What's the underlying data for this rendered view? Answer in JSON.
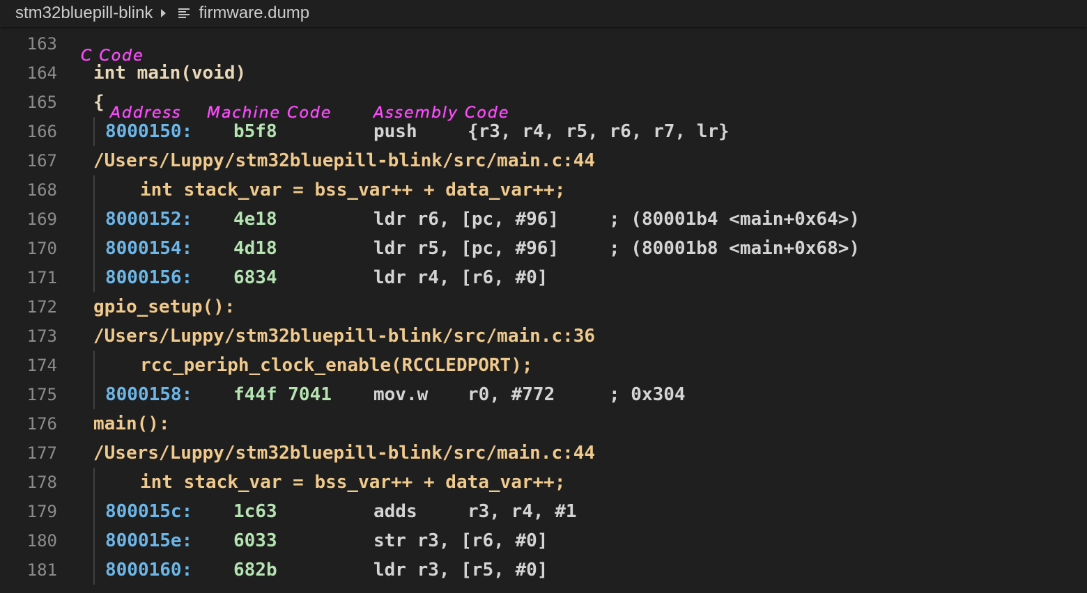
{
  "breadcrumb": {
    "folder": "stm32bluepill-blink",
    "file": "firmware.dump"
  },
  "annotations": {
    "c_code": "C Code",
    "address": "Address",
    "machine_code": "Machine Code",
    "assembly_code": "Assembly Code"
  },
  "lines": [
    {
      "num": "163",
      "kind": "blank"
    },
    {
      "num": "164",
      "kind": "plain",
      "text": "int main(void)"
    },
    {
      "num": "165",
      "kind": "plain",
      "text": "{"
    },
    {
      "num": "166",
      "kind": "asm",
      "addr": "8000150:",
      "mc": "b5f8",
      "op": "push",
      "args": "{r3, r4, r5, r6, r7, lr}",
      "comment": ""
    },
    {
      "num": "167",
      "kind": "path",
      "text": "/Users/Luppy/stm32bluepill-blink/src/main.c:44"
    },
    {
      "num": "168",
      "kind": "src",
      "text": "int stack_var = bss_var++ + data_var++;"
    },
    {
      "num": "169",
      "kind": "asm",
      "addr": "8000152:",
      "mc": "4e18",
      "op": "ldr r6, [pc, #96]",
      "args": "",
      "comment": "; (80001b4 <main+0x64>)"
    },
    {
      "num": "170",
      "kind": "asm",
      "addr": "8000154:",
      "mc": "4d18",
      "op": "ldr r5, [pc, #96]",
      "args": "",
      "comment": "; (80001b8 <main+0x68>)"
    },
    {
      "num": "171",
      "kind": "asm",
      "addr": "8000156:",
      "mc": "6834",
      "op": "ldr r4, [r6, #0]",
      "args": "",
      "comment": ""
    },
    {
      "num": "172",
      "kind": "fn",
      "text": "gpio_setup():"
    },
    {
      "num": "173",
      "kind": "path",
      "text": "/Users/Luppy/stm32bluepill-blink/src/main.c:36"
    },
    {
      "num": "174",
      "kind": "src",
      "text": "rcc_periph_clock_enable(RCCLEDPORT);"
    },
    {
      "num": "175",
      "kind": "asm",
      "addr": "8000158:",
      "mc": "f44f 7041",
      "op": "mov.w",
      "args": "r0, #772",
      "comment": "; 0x304"
    },
    {
      "num": "176",
      "kind": "fn",
      "text": "main():"
    },
    {
      "num": "177",
      "kind": "path",
      "text": "/Users/Luppy/stm32bluepill-blink/src/main.c:44"
    },
    {
      "num": "178",
      "kind": "src",
      "text": "int stack_var = bss_var++ + data_var++;"
    },
    {
      "num": "179",
      "kind": "asm",
      "addr": "800015c:",
      "mc": "1c63",
      "op": "adds",
      "args": "r3, r4, #1",
      "comment": ""
    },
    {
      "num": "180",
      "kind": "asm",
      "addr": "800015e:",
      "mc": "6033",
      "op": "str r3, [r6, #0]",
      "args": "",
      "comment": ""
    },
    {
      "num": "181",
      "kind": "asm",
      "addr": "8000160:",
      "mc": "682b",
      "op": "ldr r3, [r5, #0]",
      "args": "",
      "comment": ""
    }
  ]
}
